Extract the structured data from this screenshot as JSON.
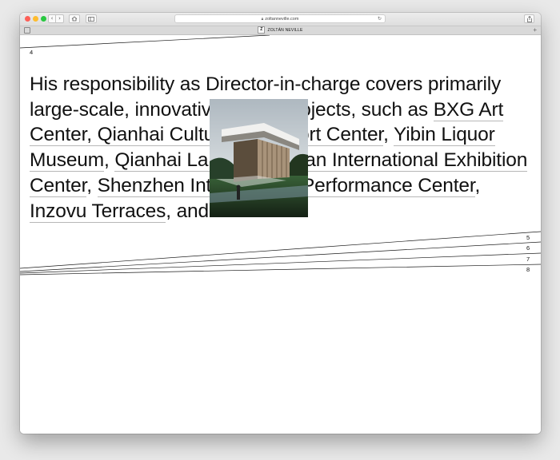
{
  "browser": {
    "url": "zoltanneville.com",
    "tab_title": "ZOLTÁN NEVILLE",
    "favicon_letter": "Z",
    "icons": {
      "back": "chevron-left-icon",
      "forward": "chevron-right-icon",
      "home": "home-icon",
      "sidebar": "sidebar-icon",
      "lock": "lock-icon",
      "reload": "reload-icon",
      "share": "share-icon",
      "new_tab": "plus-icon"
    }
  },
  "page": {
    "section_numbers": [
      "4",
      "5",
      "6",
      "7",
      "8"
    ],
    "paragraph": [
      {
        "text": "His responsibility as Director-in-charge covers primarily large-scale, innovative public projects, such as "
      },
      {
        "text": "BXG Art Center, Qianhai Culture and Sport Center",
        "link": true
      },
      {
        "text": ", "
      },
      {
        "text": "Yibin Liquor Museum",
        "link": true
      },
      {
        "text": ", "
      },
      {
        "text": "Qianhai Landmark",
        "link": true
      },
      {
        "text": ", "
      },
      {
        "text": "Xi’an International Exhibition Center",
        "link": true
      },
      {
        "text": ", "
      },
      {
        "text": "Shenzhen International Performance Center",
        "link": true
      },
      {
        "text": ", "
      },
      {
        "text": "Inzovu Terraces",
        "link": true
      },
      {
        "text": ", and more."
      }
    ],
    "image_subject": "building-rendering"
  },
  "colors": {
    "text": "#111111",
    "link_underline": "#b7b7b7",
    "page_background": "#ffffff"
  }
}
